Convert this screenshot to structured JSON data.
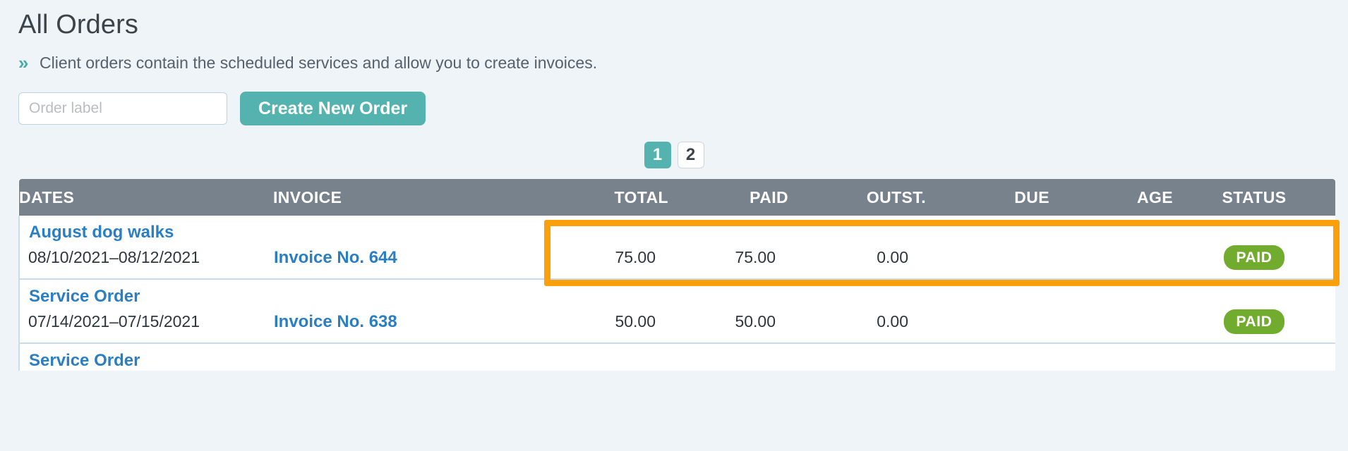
{
  "header": {
    "title": "All Orders",
    "chevrons_icon": "»",
    "subtitle": "Client orders contain the scheduled services and allow you to create invoices."
  },
  "form": {
    "order_label_placeholder": "Order label",
    "order_label_value": "",
    "create_button": "Create New Order"
  },
  "pagination": {
    "pages": [
      {
        "label": "1",
        "active": true
      },
      {
        "label": "2",
        "active": false
      }
    ]
  },
  "table": {
    "columns": [
      "DATES",
      "INVOICE",
      "TOTAL",
      "PAID",
      "OUTST.",
      "DUE",
      "AGE",
      "STATUS"
    ],
    "rows": [
      {
        "title": "August dog walks",
        "dates": "08/10/2021–08/12/2021",
        "invoice": "Invoice No. 644",
        "total": "75.00",
        "paid": "75.00",
        "outst": "0.00",
        "due": "",
        "age": "",
        "status": "PAID"
      },
      {
        "title": "Service Order",
        "dates": "07/14/2021–07/15/2021",
        "invoice": "Invoice No. 638",
        "total": "50.00",
        "paid": "50.00",
        "outst": "0.00",
        "due": "",
        "age": "",
        "status": "PAID"
      },
      {
        "title": "Service Order",
        "dates": "",
        "invoice": "",
        "total": "",
        "paid": "",
        "outst": "",
        "due": "",
        "age": "",
        "status": ""
      }
    ]
  },
  "annotation": {
    "highlight_color": "#f9a00b"
  },
  "colors": {
    "accent_teal": "#54b3ae",
    "link_blue": "#2a7fc4",
    "table_header_gray": "#77828d",
    "status_green": "#72ac2f",
    "page_background": "#eef4f8"
  }
}
